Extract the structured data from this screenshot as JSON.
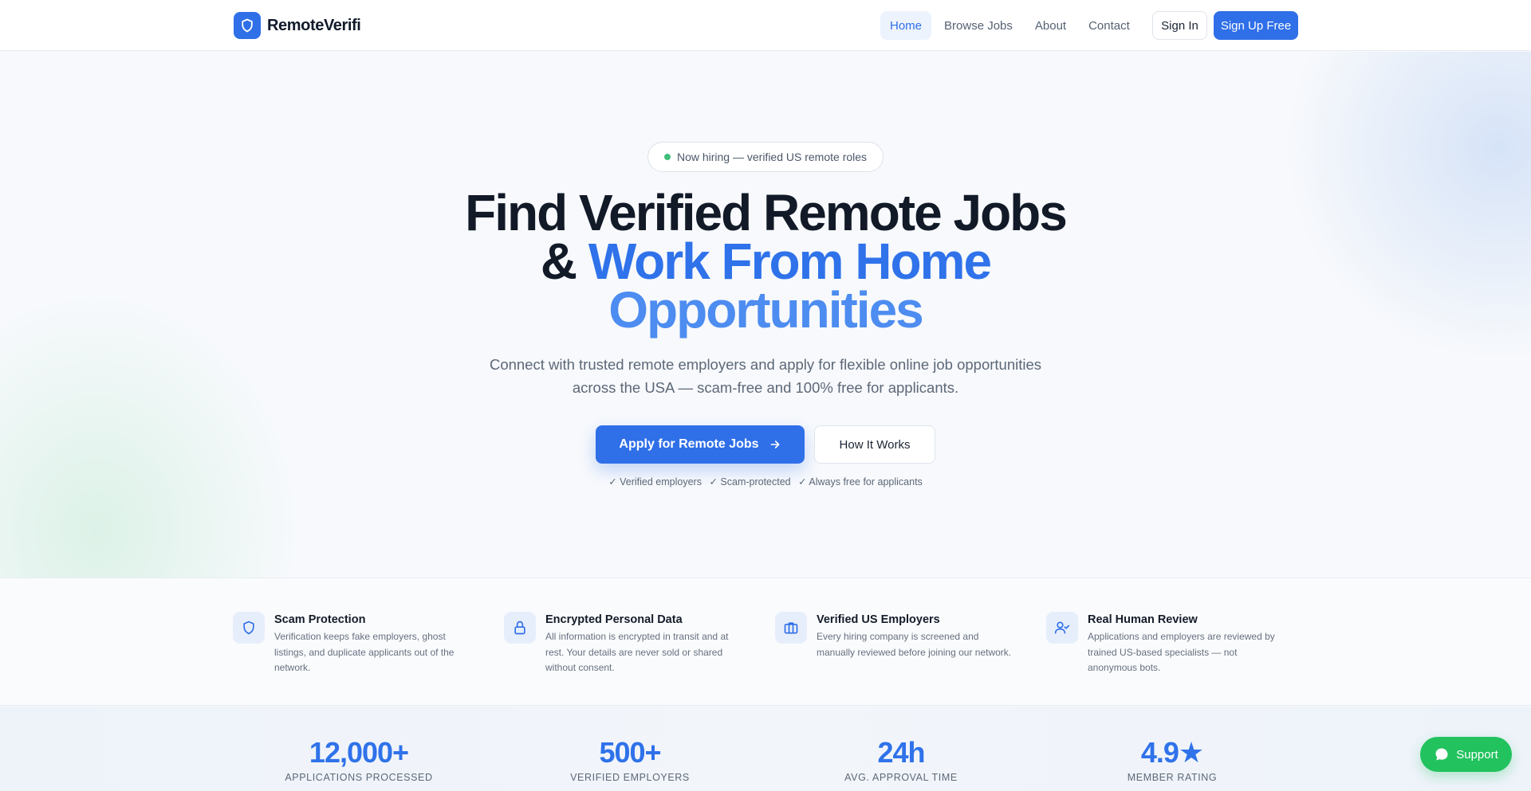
{
  "nav": {
    "brand": "RemoteVerifi",
    "links": [
      "Home",
      "Browse Jobs",
      "About",
      "Contact"
    ],
    "sign_in": "Sign In",
    "sign_up": "Sign Up Free"
  },
  "hero": {
    "pill": "Now hiring — verified US remote roles",
    "headline_line1": "Find Verified Remote Jobs",
    "headline_amp": "& ",
    "headline_blue": "Work From Home",
    "headline_line3": "Opportunities",
    "subtitle": "Connect with trusted remote employers and apply for flexible online job opportunities across the USA — scam-free and 100% free for applicants.",
    "apply_button": "Apply for Remote Jobs",
    "how_button": "How It Works",
    "trust": [
      "✓ Verified employers",
      "✓ Scam-protected",
      "✓ Always free for applicants"
    ]
  },
  "features": [
    {
      "icon": "shield-icon",
      "title": "Scam Protection",
      "desc": "Verification keeps fake employers, ghost listings, and duplicate applicants out of the network."
    },
    {
      "icon": "lock-icon",
      "title": "Encrypted Personal Data",
      "desc": "All information is encrypted in transit and at rest. Your details are never sold or shared without consent."
    },
    {
      "icon": "briefcase-icon",
      "title": "Verified US Employers",
      "desc": "Every hiring company is screened and manually reviewed before joining our network."
    },
    {
      "icon": "user-check-icon",
      "title": "Real Human Review",
      "desc": "Applications and employers are reviewed by trained US-based specialists — not anonymous bots."
    }
  ],
  "stats": [
    {
      "value": "12,000+",
      "label": "APPLICATIONS PROCESSED"
    },
    {
      "value": "500+",
      "label": "VERIFIED EMPLOYERS"
    },
    {
      "value": "24h",
      "label": "AVG. APPROVAL TIME"
    },
    {
      "value": "4.9★",
      "label": "MEMBER RATING"
    }
  ],
  "support": {
    "label": "Support"
  },
  "colors": {
    "accent": "#2f6fe8",
    "success": "#22c25e"
  }
}
